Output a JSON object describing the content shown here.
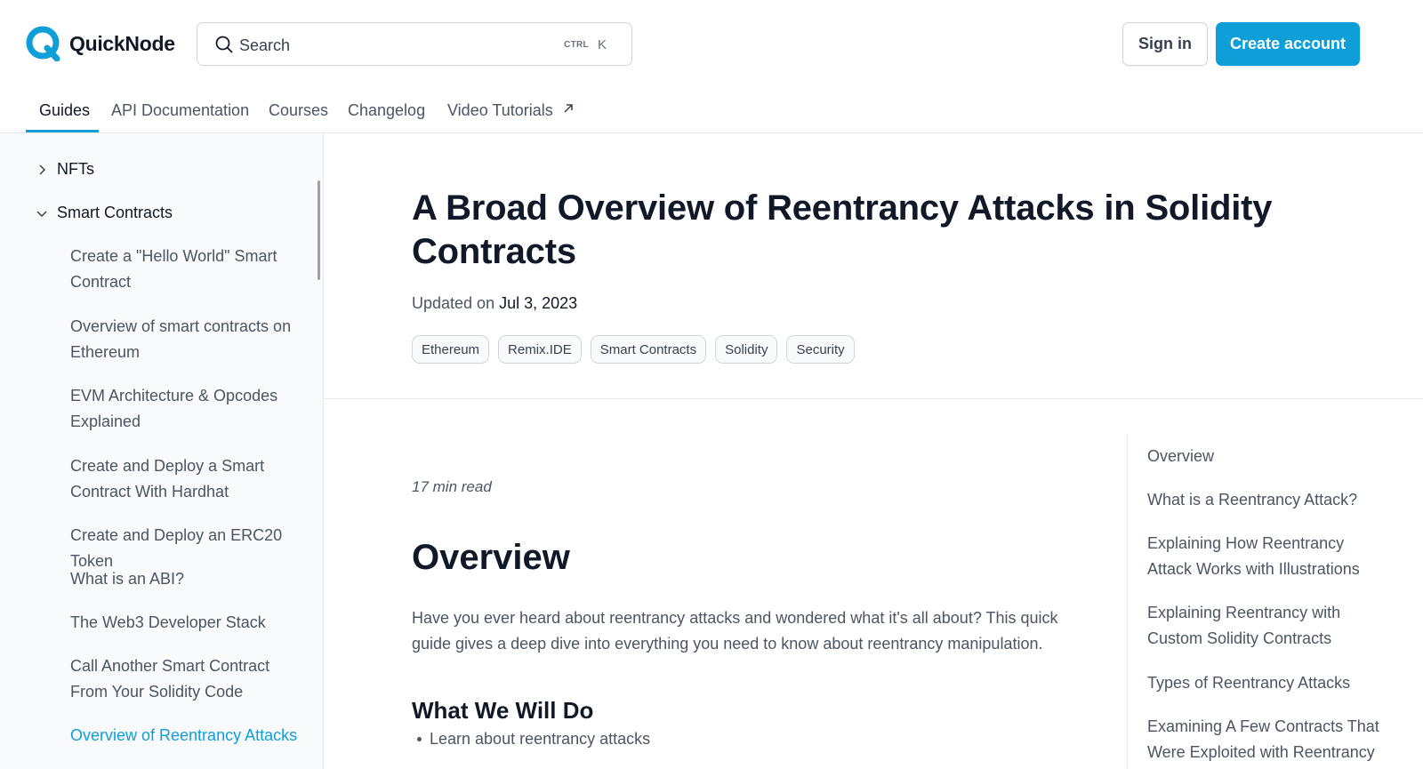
{
  "header": {
    "logo_text": "QuickNode",
    "search": {
      "placeholder": "Search",
      "shortcut_modifier": "CTRL",
      "shortcut_key": "K"
    },
    "sign_in_label": "Sign in",
    "create_account_label": "Create account"
  },
  "tabs": [
    {
      "label": "Guides",
      "active": true
    },
    {
      "label": "API Documentation"
    },
    {
      "label": "Courses"
    },
    {
      "label": "Changelog"
    },
    {
      "label": "Video Tutorials",
      "external": true
    }
  ],
  "sidebar": {
    "groups": [
      {
        "label": "NFTs",
        "expanded": false
      },
      {
        "label": "Smart Contracts",
        "expanded": true
      }
    ],
    "items": [
      {
        "label": "Create a \"Hello World\" Smart Contract"
      },
      {
        "label": "Overview of smart contracts on Ethereum"
      },
      {
        "label": "EVM Architecture & Opcodes Explained"
      },
      {
        "label": "Create and Deploy a Smart Contract With Hardhat"
      },
      {
        "label": "Create and Deploy an ERC20 Token"
      },
      {
        "label": "What is an ABI?"
      },
      {
        "label": "The Web3 Developer Stack"
      },
      {
        "label": "Call Another Smart Contract From Your Solidity Code"
      },
      {
        "label": "Overview of Reentrancy Attacks",
        "active": true
      }
    ]
  },
  "article": {
    "title": "A Broad Overview of Reentrancy Attacks in Solidity Contracts",
    "updated_prefix": "Updated on",
    "updated_date": "Jul 3, 2023",
    "tags": [
      "Ethereum",
      "Remix.IDE",
      "Smart Contracts",
      "Solidity",
      "Security"
    ],
    "read_time": "17 min read",
    "overview_heading": "Overview",
    "overview_text": "Have you ever heard about reentrancy attacks and wondered what it's all about? This quick guide gives a deep dive into everything you need to know about reentrancy manipulation.",
    "what_we_will_do_heading": "What We Will Do",
    "bullets": [
      "Learn about reentrancy attacks"
    ]
  },
  "toc": [
    "Overview",
    "What is a Reentrancy Attack?",
    "Explaining How Reentrancy Attack Works with Illustrations",
    "Explaining Reentrancy with Custom Solidity Contracts",
    "Types of Reentrancy Attacks",
    "Examining A Few Contracts That Were Exploited with Reentrancy in"
  ],
  "colors": {
    "accent": "#0e9fd8",
    "text": "#111827",
    "muted": "#4b5563",
    "border": "#e5e7eb"
  }
}
